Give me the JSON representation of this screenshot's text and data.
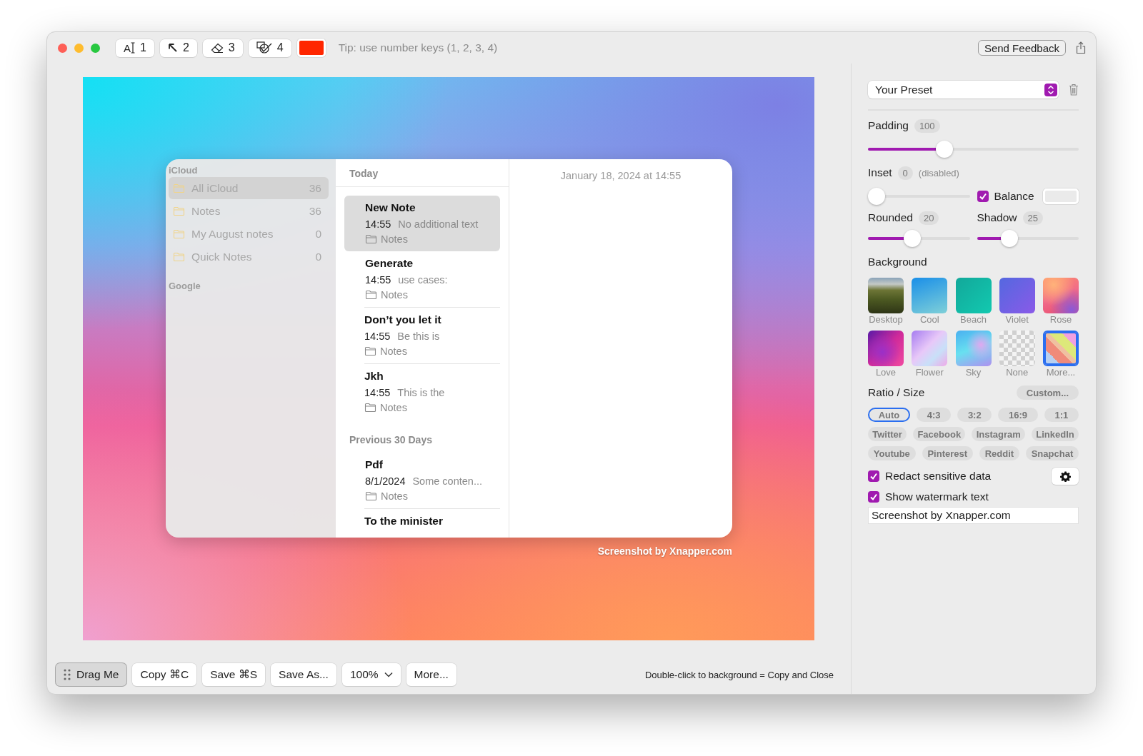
{
  "toolbar": {
    "tools": [
      {
        "kind": "text",
        "glyph": "A",
        "label": "1"
      },
      {
        "kind": "arrow",
        "label": "2"
      },
      {
        "kind": "eraser",
        "label": "3"
      },
      {
        "kind": "shapes",
        "label": "4"
      }
    ],
    "color": "#ff2600",
    "tip": "Tip: use number keys (1, 2, 3, 4)",
    "feedback_button": "Send Feedback"
  },
  "preview": {
    "notes_window": {
      "sidebar": [
        {
          "title": "iCloud",
          "items": [
            {
              "name": "All iCloud",
              "count": "36",
              "selected": true
            },
            {
              "name": "Notes",
              "count": "36",
              "selected": false
            },
            {
              "name": "My August notes",
              "count": "0",
              "selected": false
            },
            {
              "name": "Quick Notes",
              "count": "0",
              "selected": false
            }
          ]
        },
        {
          "title": "Google"
        }
      ],
      "note_sections": [
        {
          "title": "Today",
          "notes": [
            {
              "title": "New Note",
              "time": "14:55",
              "excerpt": "No additional text",
              "folder": "Notes",
              "selected": true
            },
            {
              "title": "Generate",
              "time": "14:55",
              "excerpt": "use cases:",
              "folder": "Notes",
              "selected": false
            },
            {
              "title": "Don’t you let it",
              "time": "14:55",
              "excerpt": "Be this is",
              "folder": "Notes",
              "selected": false
            },
            {
              "title": "Jkh",
              "time": "14:55",
              "excerpt": "This is the",
              "folder": "Notes",
              "selected": false
            }
          ]
        },
        {
          "title": "Previous 30 Days",
          "notes": [
            {
              "title": "Pdf",
              "time": "8/1/2024",
              "excerpt": "Some conten...",
              "folder": "Notes",
              "selected": false
            },
            {
              "title": "To the minister",
              "selected": false
            }
          ]
        }
      ],
      "detail_date": "January 18, 2024 at 14:55"
    },
    "watermark_text": "Screenshot by Xnapper.com"
  },
  "bottom_bar": {
    "buttons": [
      {
        "kind": "drag",
        "label": "Drag Me"
      },
      {
        "kind": "plain",
        "label": "Copy ⌘C"
      },
      {
        "kind": "plain",
        "label": "Save ⌘S"
      },
      {
        "kind": "plain",
        "label": "Save As..."
      },
      {
        "kind": "dropdown",
        "label": "100%"
      },
      {
        "kind": "plain",
        "label": "More..."
      }
    ],
    "hint": "Double-click to background = Copy and Close"
  },
  "settings": {
    "preset": "Your Preset",
    "padding": {
      "label": "Padding",
      "value": "100",
      "level": 0.35
    },
    "inset": {
      "label": "Inset",
      "value": "0",
      "note": "(disabled)",
      "level": 0
    },
    "balance": {
      "label": "Balance",
      "checked": true
    },
    "rounded": {
      "label": "Rounded",
      "value": "20",
      "level": 0.42
    },
    "shadow": {
      "label": "Shadow",
      "value": "25",
      "level": 0.28
    },
    "background": {
      "title": "Background",
      "options": [
        {
          "kind": "photo",
          "label": "Desktop",
          "selected": false
        },
        {
          "kind": "cool",
          "label": "Cool",
          "selected": false
        },
        {
          "kind": "beach",
          "label": "Beach",
          "selected": false
        },
        {
          "kind": "violet",
          "label": "Violet",
          "selected": false
        },
        {
          "kind": "rose",
          "label": "Rose",
          "selected": false
        },
        {
          "kind": "love",
          "label": "Love",
          "selected": false
        },
        {
          "kind": "flower",
          "label": "Flower",
          "selected": false
        },
        {
          "kind": "sky",
          "label": "Sky",
          "selected": false
        },
        {
          "kind": "none",
          "label": "None",
          "selected": false
        },
        {
          "kind": "more",
          "label": "More...",
          "selected": true
        }
      ]
    },
    "ratio": {
      "title": "Ratio / Size",
      "custom_button": "Custom...",
      "rows": [
        [
          {
            "label": "Auto",
            "selected": true
          },
          {
            "label": "4:3",
            "selected": false
          },
          {
            "label": "3:2",
            "selected": false
          },
          {
            "label": "16:9",
            "selected": false
          },
          {
            "label": "1:1",
            "selected": false
          }
        ],
        [
          {
            "label": "Twitter",
            "selected": false
          },
          {
            "label": "Facebook",
            "selected": false
          },
          {
            "label": "Instagram",
            "selected": false
          },
          {
            "label": "LinkedIn",
            "selected": false
          }
        ],
        [
          {
            "label": "Youtube",
            "selected": false
          },
          {
            "label": "Pinterest",
            "selected": false
          },
          {
            "label": "Reddit",
            "selected": false
          },
          {
            "label": "Snapchat",
            "selected": false
          }
        ]
      ]
    },
    "redact": {
      "label": "Redact sensitive data",
      "checked": true
    },
    "watermark": {
      "label": "Show watermark text",
      "checked": true,
      "value": "Screenshot by Xnapper.com"
    }
  }
}
